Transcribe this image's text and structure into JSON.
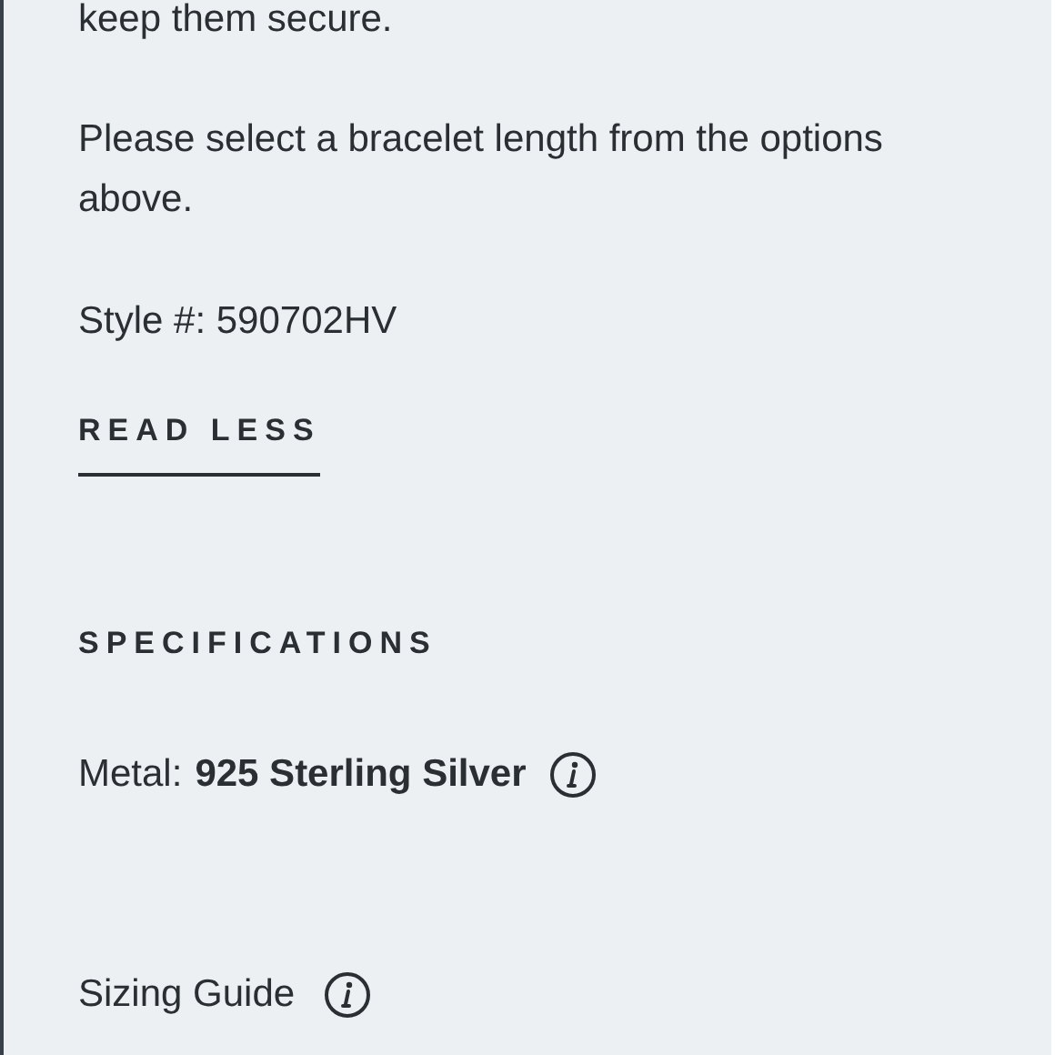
{
  "description": {
    "paragraphs": [
      "keep them secure.",
      "Please select a bracelet length from the options above."
    ],
    "style_number": "Style #: 590702HV",
    "toggle_link": "READ LESS"
  },
  "specifications": {
    "heading": "SPECIFICATIONS",
    "attributes": [
      {
        "label": "Metal:",
        "value": "925 Sterling Silver"
      }
    ]
  },
  "sizing_guide": {
    "label": "Sizing Guide"
  }
}
